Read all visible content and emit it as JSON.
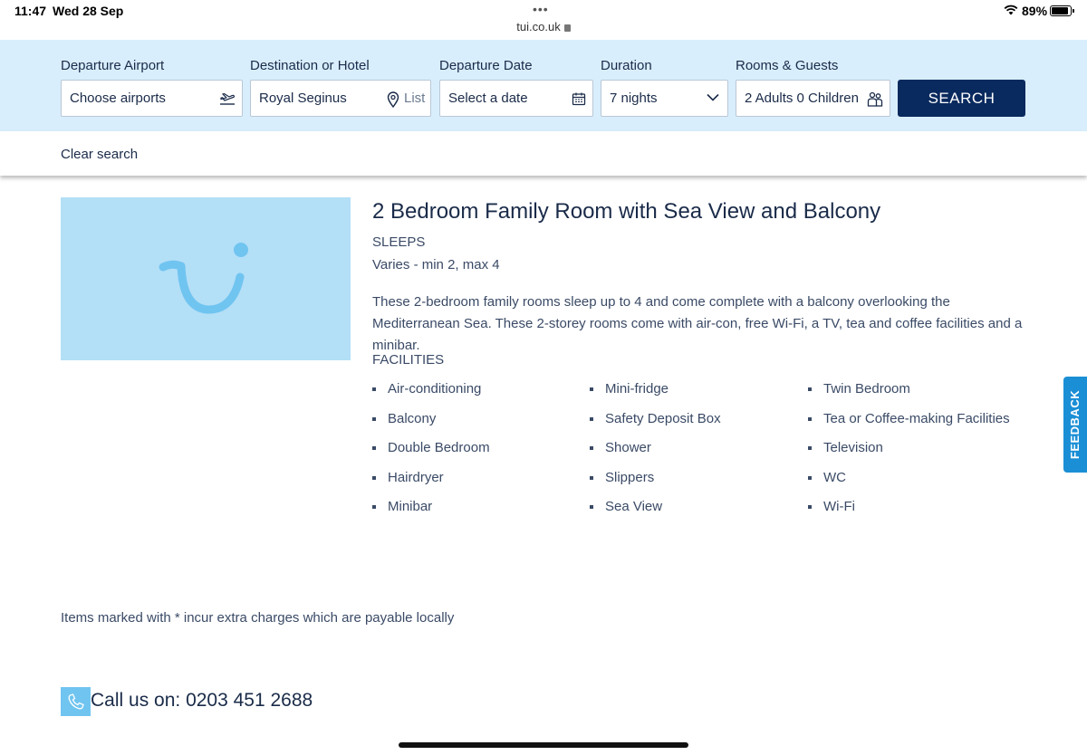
{
  "status_bar": {
    "time": "11:47",
    "date": "Wed 28 Sep",
    "url": "tui.co.uk",
    "battery_percent": "89%",
    "battery_level": 0.89
  },
  "search": {
    "departure_airport": {
      "label": "Departure Airport",
      "value": "Choose airports",
      "icon": "plane-departure-icon"
    },
    "destination": {
      "label": "Destination or Hotel",
      "value": "Royal Seginus",
      "list_label": "List",
      "icon": "map-pin-icon"
    },
    "departure_date": {
      "label": "Departure Date",
      "value": "Select a date",
      "icon": "calendar-icon"
    },
    "duration": {
      "label": "Duration",
      "value": "7 nights",
      "icon": "chevron-down-icon"
    },
    "rooms_guests": {
      "label": "Rooms & Guests",
      "value": "2 Adults 0 Children",
      "icon": "guests-icon"
    },
    "search_button": "SEARCH",
    "clear_search": "Clear search"
  },
  "room": {
    "title": "2 Bedroom Family Room with Sea View and Balcony",
    "sleeps_label": "SLEEPS",
    "sleeps_value": "Varies - min 2, max 4",
    "description": "These 2-bedroom family rooms sleep up to 4 and come complete with a balcony overlooking the Mediterranean Sea. These 2-storey rooms come with air-con, free Wi-Fi, a TV, tea and coffee facilities and a minibar.",
    "facilities_label": "FACILITIES",
    "facilities": [
      [
        "Air-conditioning",
        "Balcony",
        "Double Bedroom",
        "Hairdryer",
        "Minibar"
      ],
      [
        "Mini-fridge",
        "Safety Deposit Box",
        "Shower",
        "Slippers",
        "Sea View"
      ],
      [
        "Twin Bedroom",
        "Tea or Coffee-making Facilities",
        "Television",
        "WC",
        "Wi-Fi"
      ]
    ]
  },
  "charges_note": "Items marked with * incur extra charges which are payable locally",
  "call": {
    "text": "Call us on:",
    "number": "0203 451 2688"
  },
  "feedback_label": "FEEDBACK",
  "colors": {
    "panel_bg": "#d9eefc",
    "brand_navy": "#092a5e",
    "tui_light_blue": "#70c4f0",
    "feedback_blue": "#1b8fd6"
  }
}
